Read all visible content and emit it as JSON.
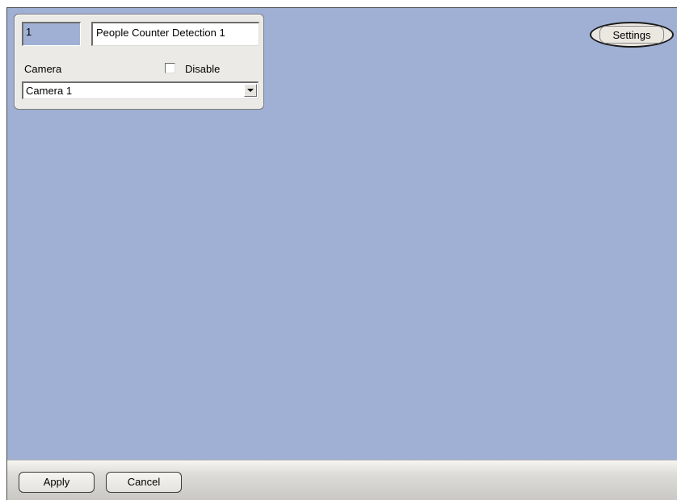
{
  "panel": {
    "id_value": "1",
    "name_value": "People Counter Detection 1",
    "camera_label": "Camera",
    "disable_label": "Disable",
    "disable_checked": false,
    "camera_selected": "Camera 1"
  },
  "settings": {
    "label": "Settings"
  },
  "footer": {
    "apply_label": "Apply",
    "cancel_label": "Cancel"
  },
  "colors": {
    "workspace_bg": "#9fb0d4",
    "panel_bg": "#ebeae6"
  },
  "icons": {
    "dropdown": "chevron-down-icon"
  }
}
